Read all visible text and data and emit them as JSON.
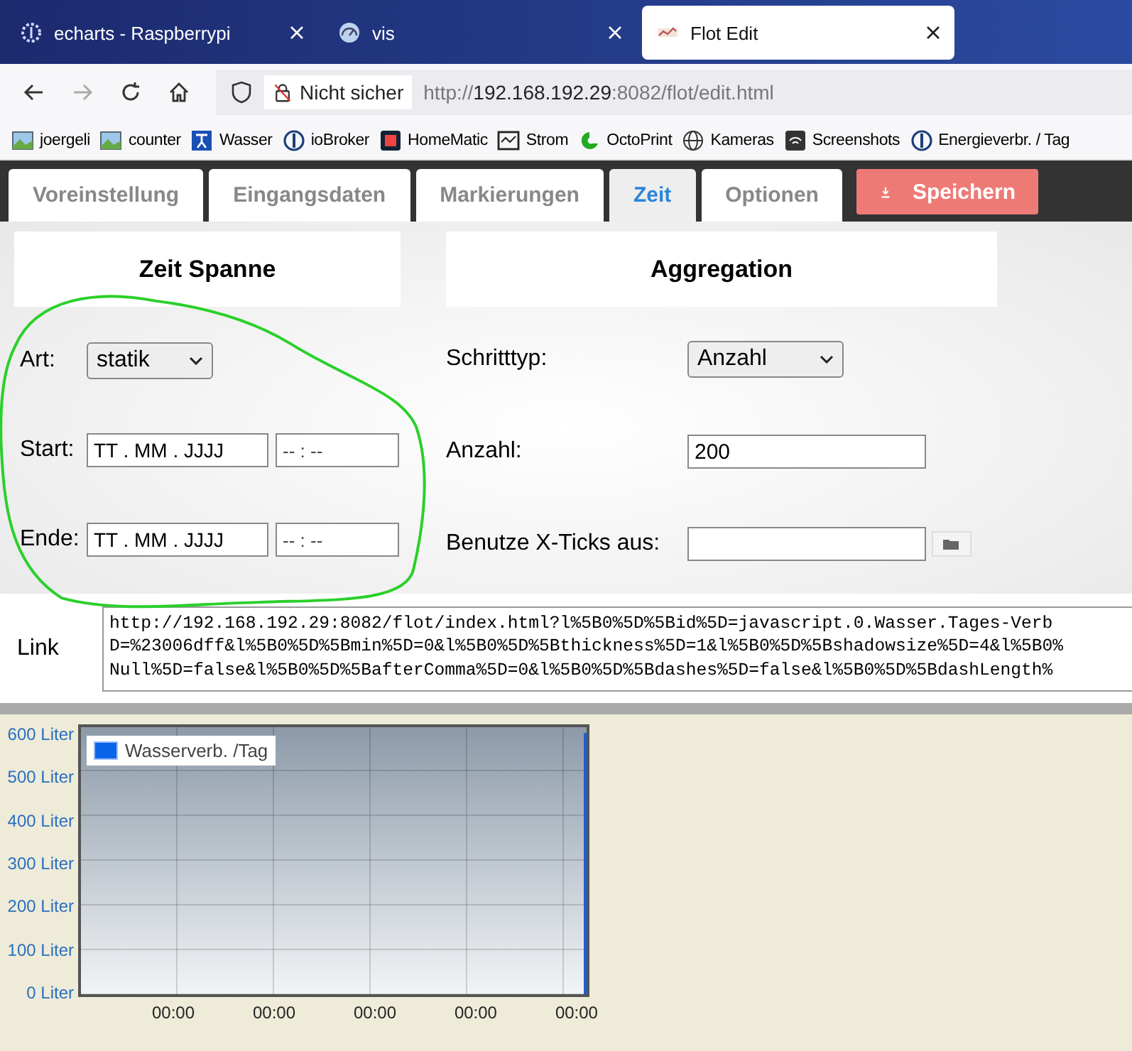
{
  "browser": {
    "tabs": [
      {
        "title": "echarts - Raspberrypi",
        "selected": false
      },
      {
        "title": "vis",
        "selected": false
      },
      {
        "title": "Flot Edit",
        "selected": true
      }
    ],
    "address": {
      "security_label": "Nicht sicher",
      "url_scheme": "http://",
      "url_host": "192.168.192.29",
      "url_path": ":8082/flot/edit.html"
    },
    "bookmarks": [
      "joergeli",
      "counter",
      "Wasser",
      "ioBroker",
      "HomeMatic",
      "Strom",
      "OctoPrint",
      "Kameras",
      "Screenshots",
      "Energieverbr. / Tag"
    ]
  },
  "app_tabs": [
    {
      "label": "Voreinstellung",
      "selected": false
    },
    {
      "label": "Eingangsdaten",
      "selected": false
    },
    {
      "label": "Markierungen",
      "selected": false
    },
    {
      "label": "Zeit",
      "selected": true
    },
    {
      "label": "Optionen",
      "selected": false
    }
  ],
  "save_button": "Speichern",
  "zeit_spanne": {
    "title": "Zeit Spanne",
    "art": {
      "label": "Art:",
      "value": "statik"
    },
    "start": {
      "label": "Start:",
      "date": "TT . MM . JJJJ",
      "time": "-- : --"
    },
    "ende": {
      "label": "Ende:",
      "date": "TT . MM . JJJJ",
      "time": "-- : --"
    }
  },
  "aggregation": {
    "title": "Aggregation",
    "schritttyp": {
      "label": "Schritttyp:",
      "value": "Anzahl"
    },
    "anzahl": {
      "label": "Anzahl:",
      "value": "200"
    },
    "xticks": {
      "label": "Benutze X-Ticks aus:"
    }
  },
  "link": {
    "label": "Link",
    "lines": [
      "http://192.168.192.29:8082/flot/index.html?l%5B0%5D%5Bid%5D=javascript.0.Wasser.Tages-Verb",
      "D=%23006dff&l%5B0%5D%5Bmin%5D=0&l%5B0%5D%5Bthickness%5D=1&l%5B0%5D%5Bshadowsize%5D=4&l%5B0%",
      "Null%5D=false&l%5B0%5D%5BafterComma%5D=0&l%5B0%5D%5Bdashes%5D=false&l%5B0%5D%5BdashLength%"
    ]
  },
  "chart": {
    "legend": "Wasserverb. /Tag",
    "y_labels": [
      "600 Liter",
      "500 Liter",
      "400 Liter",
      "300 Liter",
      "200 Liter",
      "100 Liter",
      "0 Liter"
    ],
    "x_labels": [
      "00:00",
      "00:00",
      "00:00",
      "00:00",
      "00:00"
    ]
  }
}
